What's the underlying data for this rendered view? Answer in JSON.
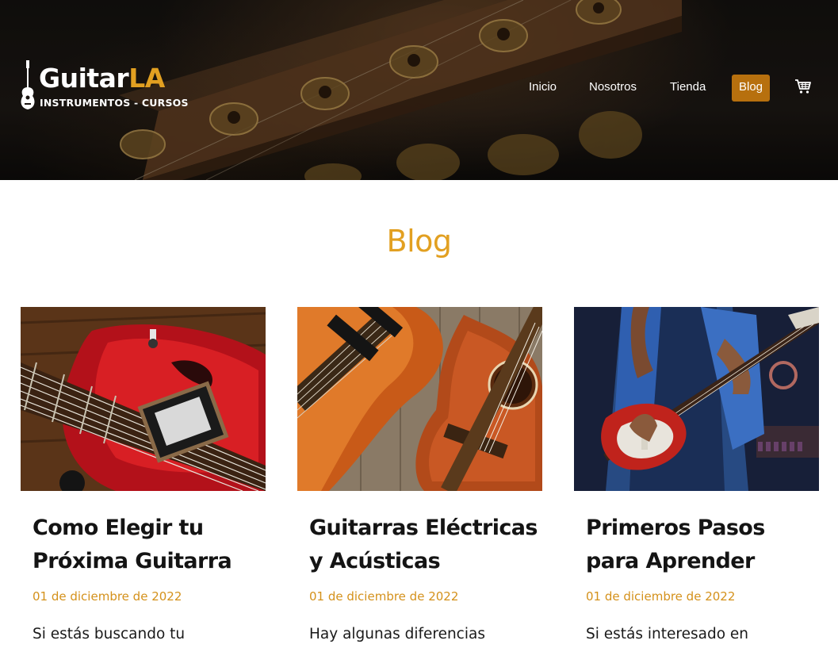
{
  "header": {
    "logo": {
      "name_white": "Guitar",
      "name_accent": "LA",
      "tagline": "INSTRUMENTOS - CURSOS"
    },
    "nav": [
      {
        "label": "Inicio",
        "active": false
      },
      {
        "label": "Nosotros",
        "active": false
      },
      {
        "label": "Tienda",
        "active": false
      },
      {
        "label": "Blog",
        "active": true
      }
    ],
    "cart_icon": "cart-icon"
  },
  "main": {
    "title": "Blog",
    "posts": [
      {
        "title": "Como Elegir tu Próxima Guitarra",
        "date": "01 de diciembre de 2022",
        "excerpt": "Si estás buscando tu",
        "image": "red-electric-guitar-closeup"
      },
      {
        "title": "Guitarras Eléctricas y Acústicas",
        "date": "01 de diciembre de 2022",
        "excerpt": "Hay algunas diferencias",
        "image": "electric-and-acoustic-guitars-on-wood"
      },
      {
        "title": "Primeros Pasos para Aprender",
        "date": "01 de diciembre de 2022",
        "excerpt": "Si estás interesado en",
        "image": "person-playing-red-electric-guitar"
      }
    ]
  },
  "colors": {
    "accent": "#e2a021",
    "nav_active_bg": "#b7700e",
    "date": "#d4911b",
    "text": "#141414"
  }
}
